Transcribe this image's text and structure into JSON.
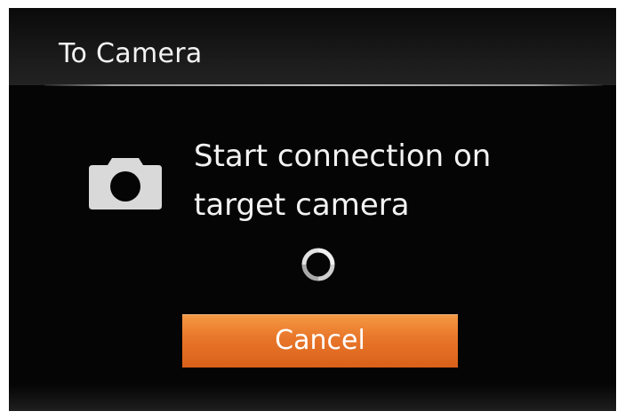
{
  "dialog": {
    "title": "To Camera",
    "message_line1": "Start connection on",
    "message_line2": "target camera",
    "cancel_label": "Cancel"
  },
  "icons": {
    "main": "camera-icon",
    "status": "loading-spinner-icon"
  },
  "colors": {
    "background": "#050505",
    "text": "#f2f2f2",
    "button_accent": "#e8762a",
    "icon": "#d9d9d9"
  }
}
